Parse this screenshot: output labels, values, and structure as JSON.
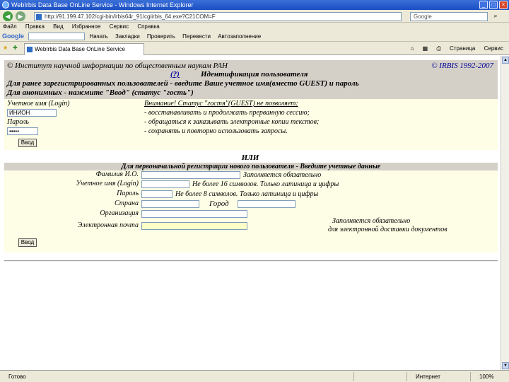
{
  "window": {
    "title": "WebIrbis Data Base OnLine Service - Windows Internet Explorer"
  },
  "browser": {
    "url": "http://91.199.47.102/cgi-bin/irbis64r_91/cgiirbis_64.exe?C21COM=F",
    "search_placeholder": "Google",
    "menu": [
      "Файл",
      "Правка",
      "Вид",
      "Избранное",
      "Сервис",
      "Справка"
    ],
    "google_label": "Google",
    "google_tools": [
      "Начать",
      "Закладки",
      "Проверить",
      "Перевести",
      "Автозаполнение"
    ],
    "tab_title": "WebIrbis Data Base OnLine Service",
    "tab_tools": [
      "Страница",
      "Сервис"
    ]
  },
  "header": {
    "copyright_left": "© Институт научной информации по общественным наукам РАН",
    "copyright_right": "© IRBIS 1992-2007",
    "help_link": "(?)",
    "title": "Идентификация пользователя",
    "line1": "Для ранее зарегистрированных пользователей - введите Ваше учетное имя(вместо GUEST) и пароль",
    "line2": "Для анонимных - нажмите \"Ввод\" (статус \"гость\")"
  },
  "login": {
    "login_label": "Учетное имя (Login)",
    "login_value": "ИНИОН",
    "password_label": "Пароль",
    "password_value": "•••••",
    "submit_label": "Ввод",
    "warn_title": "Внимание! Статус \"гостя\"(GUEST) не позволяет:",
    "warn_items": [
      "- восстанавливать и продолжать прерванную сессию;",
      "- обращаться к заказывать электронные копии текстов;",
      "- сохранять и повторно использовать запросы."
    ]
  },
  "or_label": "ИЛИ",
  "registration": {
    "header": "Для первоначальной регистрации нового пользователя - Введите учетные данные",
    "fio_label": "Фамилия И.О.",
    "fio_hint": "Заполняется обязательно",
    "login_label": "Учетное имя (Login)",
    "login_hint": "Не более 16 символов. Только латиница и цифры",
    "password_label": "Пароль",
    "password_hint": "Не более 8 символов. Только латиница и цифры",
    "country_label": "Страна",
    "city_label": "Город",
    "org_label": "Организация",
    "email_label": "Электронная почта",
    "email_hint1": "Заполняется обязательно",
    "email_hint2": "для электронной доставки документов",
    "submit_label": "Ввод"
  },
  "status": {
    "text": "Готово",
    "zone": "Интернет",
    "zoom": "100%"
  }
}
